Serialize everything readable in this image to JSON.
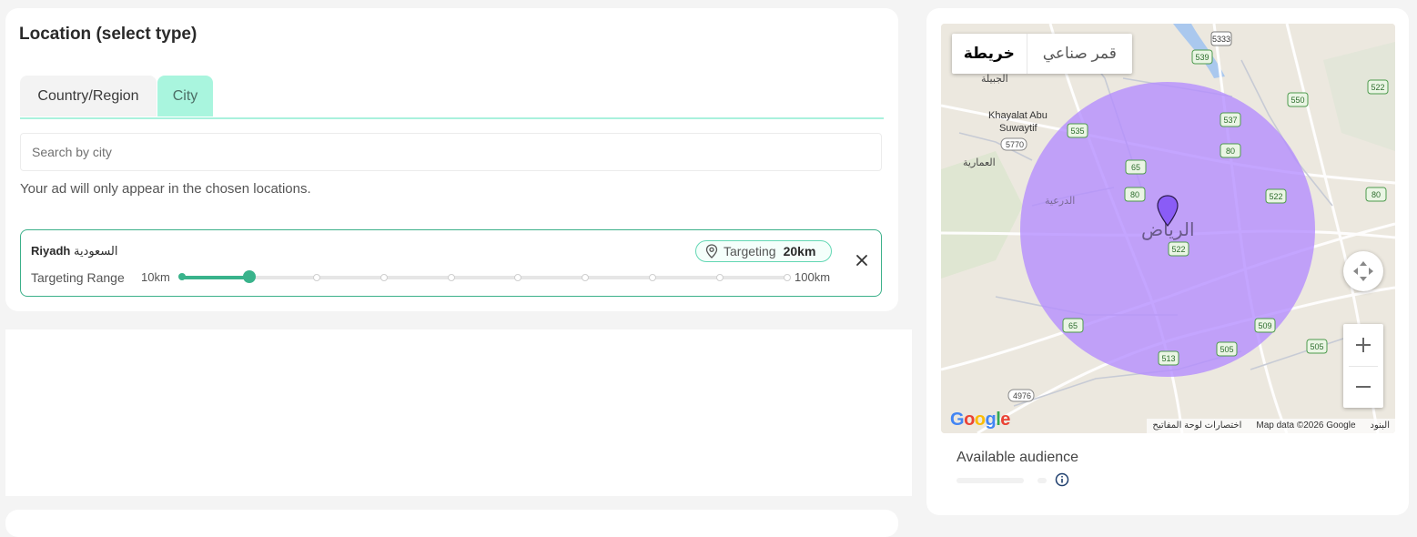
{
  "location": {
    "title": "Location (select type)",
    "tabs": [
      {
        "label": "Country/Region",
        "active": false
      },
      {
        "label": "City",
        "active": true
      }
    ],
    "search_placeholder": "Search by city",
    "hint": "Your ad will only appear in the chosen locations.",
    "selected": {
      "city": "Riyadh",
      "country": "السعودية",
      "targeting_label": "Targeting",
      "targeting_value": "20km",
      "range_label": "Targeting Range",
      "range_min": "10km",
      "range_max": "100km",
      "range_steps": [
        "10km",
        "20km",
        "30km",
        "40km",
        "50km",
        "60km",
        "70km",
        "80km",
        "90km",
        "100km"
      ],
      "selected_step_index": 1
    }
  },
  "map": {
    "type_map_label": "خريطة",
    "type_satellite_label": "قمر صناعي",
    "active_type": "map",
    "city_label": "الرياض",
    "labels": {
      "khayalat_1": "Khayalat Abu",
      "khayalat_2": "Suwaytif",
      "al_jubaylah": "الجبيلة",
      "al_ammariyah": "العمارية",
      "diriyah": "الدرعية",
      "road_5770": "5770",
      "road_4976": "4976"
    },
    "road_shields": [
      "5333",
      "539",
      "550",
      "522",
      "537",
      "535",
      "80",
      "65",
      "80",
      "522",
      "522",
      "80",
      "65",
      "509",
      "505",
      "513",
      "505"
    ],
    "attribution": {
      "shortcuts": "اختصارات لوحة المفاتيح",
      "data": "Map data ©2026 Google",
      "terms": "البنود"
    },
    "logo": "Google",
    "radius_color": "#b48cff",
    "pin_color": "#8a5cf6"
  },
  "audience": {
    "title": "Available audience"
  },
  "colors": {
    "accent": "#39b38b",
    "tab_active_bg": "#a9f5de"
  }
}
